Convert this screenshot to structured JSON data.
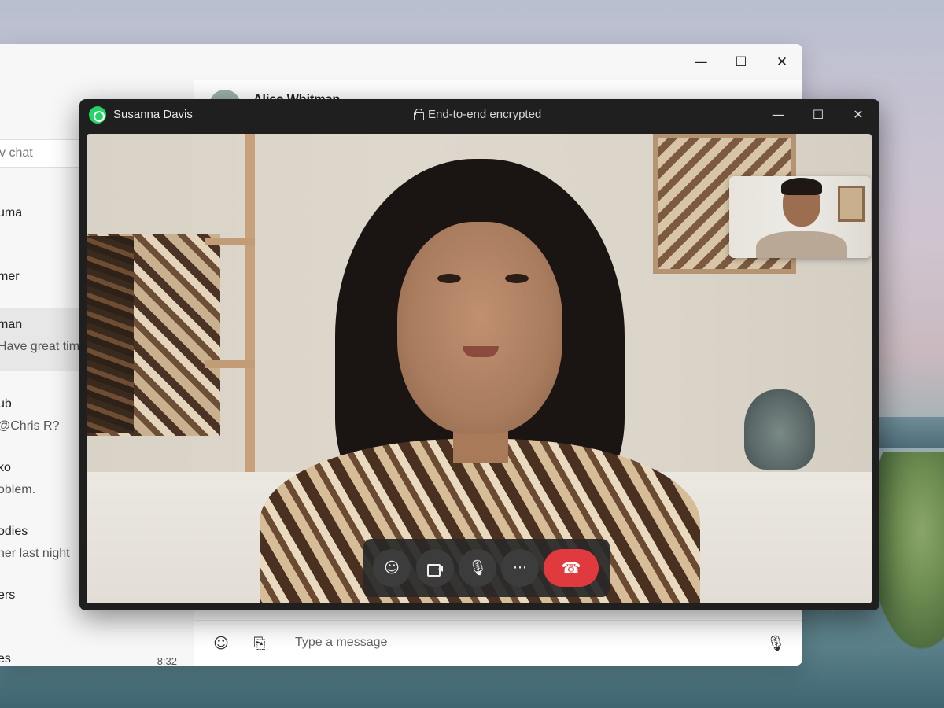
{
  "back_window": {
    "controls": {
      "minimize": "—",
      "maximize": "☐",
      "close": "✕"
    },
    "search_placeholder": "v chat",
    "chats": [
      {
        "name": "uma",
        "preview": "",
        "time": ""
      },
      {
        "name": "mer",
        "preview": "",
        "time": ""
      },
      {
        "name": "man",
        "preview": "Have great time",
        "time": "",
        "active": true
      },
      {
        "name": "ub",
        "preview": "@Chris R?",
        "time": ""
      },
      {
        "name": "ko",
        "preview": "oblem.",
        "time": ""
      },
      {
        "name": "odies",
        "preview": "her last night",
        "time": ""
      },
      {
        "name": "ers",
        "preview": "",
        "time": ""
      },
      {
        "name": "es",
        "preview": "",
        "time": "8:32"
      }
    ],
    "header_name": "Alice Whitman",
    "composer": {
      "emoji_icon": "☺",
      "attach_icon": "⎘",
      "placeholder": "Type a message",
      "mic_icon": "🎙"
    }
  },
  "call_window": {
    "caller_name": "Susanna Davis",
    "encryption_label": "End-to-end encrypted",
    "controls": {
      "minimize": "—",
      "maximize": "☐",
      "close": "✕"
    },
    "call_buttons": {
      "effects_icon": "☺",
      "mic_icon": "🎙",
      "more_icon": "···",
      "end_icon": "☎"
    },
    "colors": {
      "end_call": "#e0393e",
      "whatsapp_green": "#25d366"
    }
  }
}
